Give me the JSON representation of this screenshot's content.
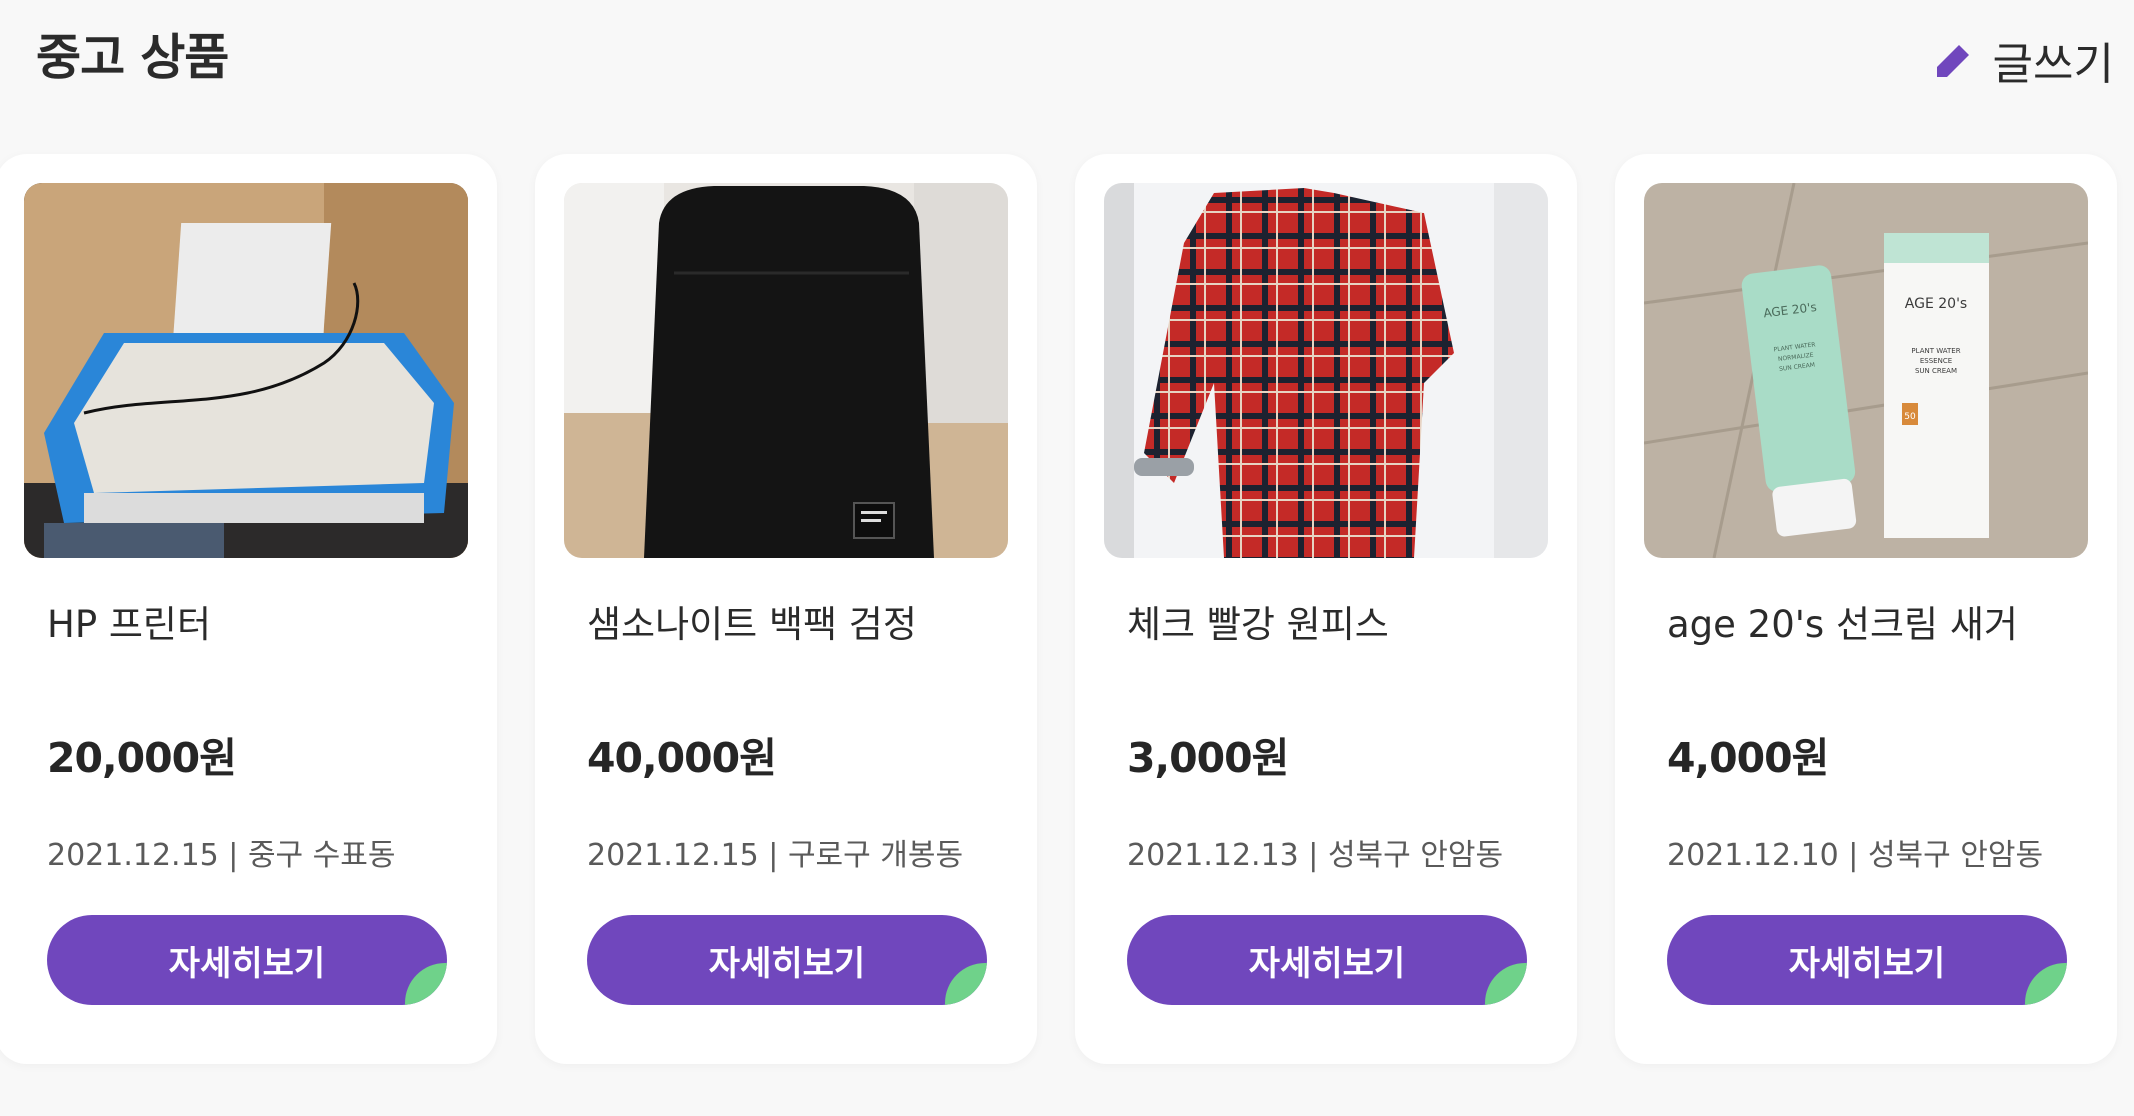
{
  "header": {
    "title": "중고 상품",
    "write_label": "글쓰기",
    "write_icon": "pencil-icon"
  },
  "colors": {
    "accent": "#7047bd",
    "corner_accent": "#6fd28a",
    "background": "#f8f8f8",
    "card": "#ffffff"
  },
  "products": [
    {
      "title": "HP 프린터",
      "price": "20,000원",
      "meta": "2021.12.15 | 중구 수표동",
      "button_label": "자세히보기"
    },
    {
      "title": "샘소나이트 백팩 검정",
      "price": "40,000원",
      "meta": "2021.12.15 | 구로구 개봉동",
      "button_label": "자세히보기"
    },
    {
      "title": "체크 빨강 원피스",
      "price": "3,000원",
      "meta": "2021.12.13 | 성북구 안암동",
      "button_label": "자세히보기"
    },
    {
      "title": "age 20's 선크림 새거",
      "price": "4,000원",
      "meta": "2021.12.10 | 성북구 안암동",
      "button_label": "자세히보기"
    }
  ],
  "product_images": {
    "card_1": {
      "label_lines": []
    },
    "card_2": {
      "label_lines": []
    },
    "card_3": {
      "label_lines": []
    },
    "card_4": {
      "tube_brand": "AGE 20's",
      "box_brand": "AGE 20's",
      "tube_lines": [
        "PLANT WATER",
        "NORMALIZE",
        "SUN CREAM"
      ],
      "box_lines": [
        "PLANT WATER",
        "ESSENCE",
        "SUN CREAM"
      ],
      "spf": "50"
    }
  }
}
